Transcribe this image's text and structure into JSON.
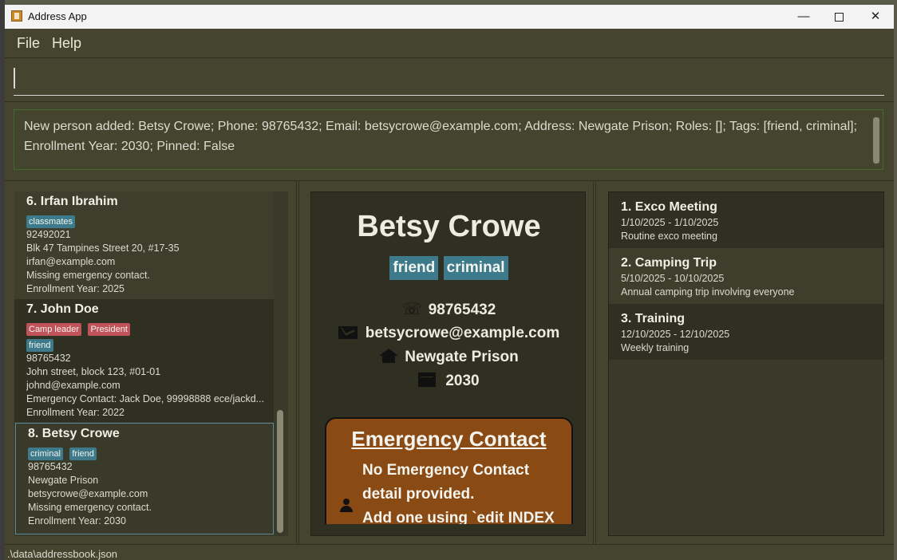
{
  "window": {
    "title": "Address App"
  },
  "menu": {
    "file": "File",
    "help": "Help"
  },
  "command": {
    "value": ""
  },
  "result": {
    "message": "New person added: Betsy Crowe; Phone: 98765432; Email: betsycrowe@example.com; Address: Newgate Prison; Roles: []; Tags: [friend, criminal]; Enrollment Year: 2030; Pinned: False"
  },
  "persons": [
    {
      "name": "6. Irfan Ibrahim",
      "tags": [
        "classmates"
      ],
      "phone": "92492021",
      "address": "Blk 47 Tampines Street 20, #17-35",
      "email": "irfan@example.com",
      "emergency": "Missing emergency contact.",
      "year": "Enrollment Year: 2025"
    },
    {
      "name": "7. John Doe",
      "roles": [
        "Camp leader",
        "President"
      ],
      "tags": [
        "friend"
      ],
      "phone": "98765432",
      "address": "John street, block 123, #01-01",
      "email": "johnd@example.com",
      "emergency": "Emergency Contact: Jack Doe, 99998888 ece/jackd...",
      "year": "Enrollment Year: 2022"
    },
    {
      "name": "8. Betsy Crowe",
      "tags": [
        "criminal",
        "friend"
      ],
      "phone": "98765432",
      "address": "Newgate Prison",
      "email": "betsycrowe@example.com",
      "emergency": "Missing emergency contact.",
      "year": "Enrollment Year: 2030"
    }
  ],
  "detail": {
    "name": "Betsy Crowe",
    "tags": [
      "friend",
      "criminal"
    ],
    "phone": "98765432",
    "email": "betsycrowe@example.com",
    "address": "Newgate Prison",
    "year": "2030",
    "emergency_title": "Emergency Contact",
    "emergency_line1": "No Emergency Contact",
    "emergency_line2": "detail provided.",
    "emergency_line3": "Add one using `edit INDEX"
  },
  "events": [
    {
      "title": "1. Exco Meeting",
      "dates": "1/10/2025 - 1/10/2025",
      "desc": "Routine exco meeting"
    },
    {
      "title": "2. Camping Trip",
      "dates": "5/10/2025 - 10/10/2025",
      "desc": "Annual camping trip involving everyone"
    },
    {
      "title": "3. Training",
      "dates": "12/10/2025 - 12/10/2025",
      "desc": "Weekly training"
    }
  ],
  "status": {
    "path": ".\\data\\addressbook.json"
  },
  "icons": {
    "app": "app-icon",
    "phone": "phone-icon",
    "email": "email-icon",
    "address": "home-icon",
    "year": "calendar-icon",
    "contact": "person-icon"
  },
  "colors": {
    "background": "#44442e",
    "tag": "#3c7a8c",
    "role": "#c0525a",
    "emergency": "#8a4a14"
  }
}
